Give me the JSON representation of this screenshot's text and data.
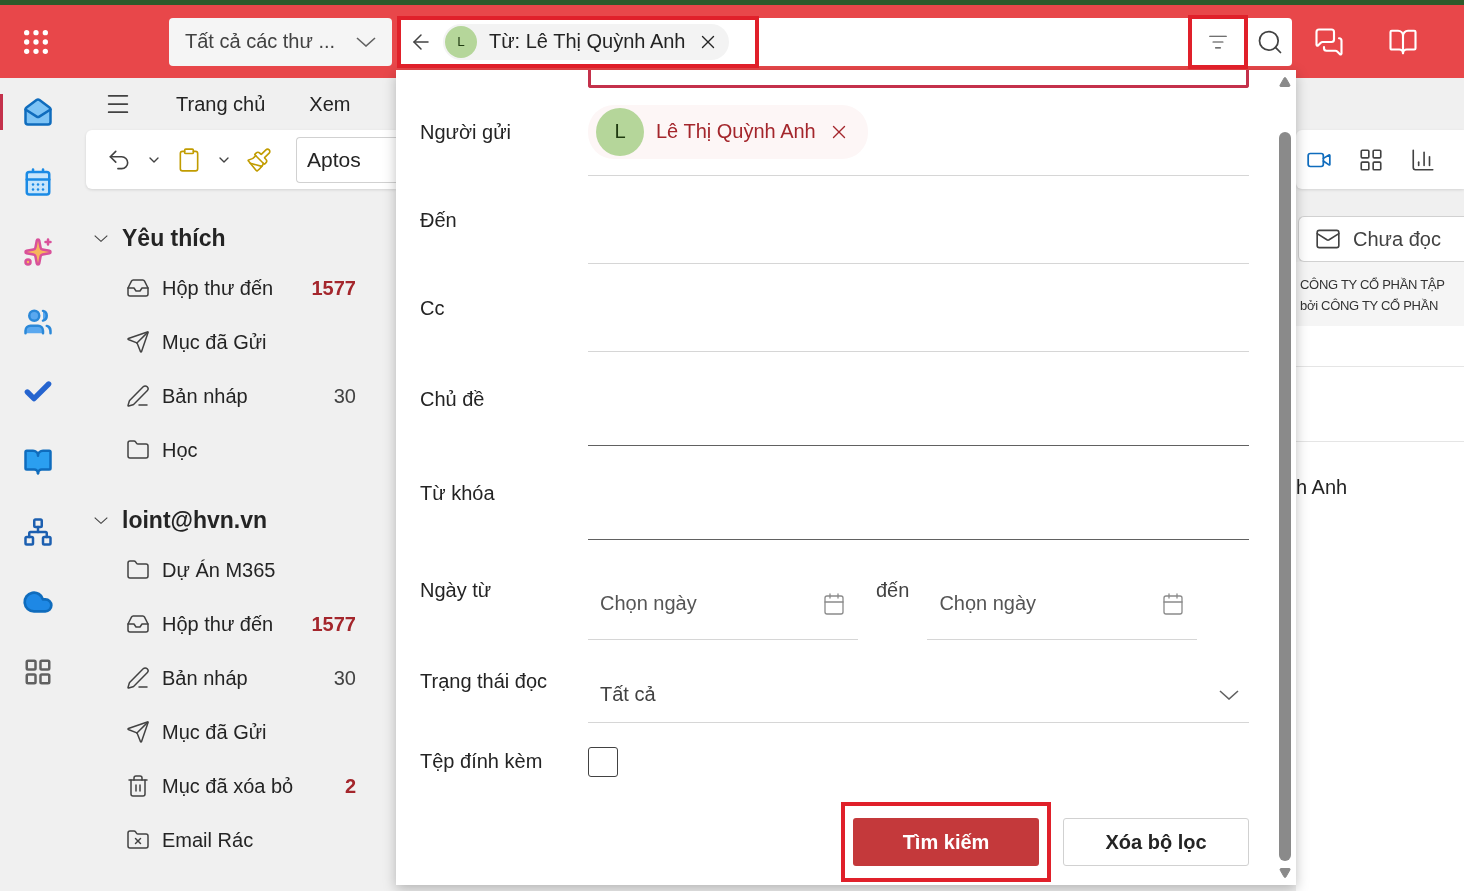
{
  "header": {
    "scope": "Tất cả các thư ...",
    "search_chip": {
      "initial": "L",
      "label": "Từ: Lê Thị Quỳnh Anh",
      "highlighted": true
    },
    "filter_button": {
      "highlighted": true
    }
  },
  "rail": [
    {
      "kind": "mail",
      "selected": true
    },
    {
      "kind": "calendar",
      "selected": false
    },
    {
      "kind": "copilot",
      "selected": false
    },
    {
      "kind": "people",
      "selected": false
    },
    {
      "kind": "todo",
      "selected": false
    },
    {
      "kind": "notes",
      "selected": false
    },
    {
      "kind": "org",
      "selected": false
    },
    {
      "kind": "cloud",
      "selected": false
    },
    {
      "kind": "apps",
      "selected": false
    }
  ],
  "ribbon": {
    "tabs": [
      "Trang chủ",
      "Xem"
    ],
    "font": "Aptos"
  },
  "folders": [
    {
      "title": "Yêu thích",
      "expanded": true,
      "children": [
        {
          "kind": "inbox",
          "label": "Hộp thư đến",
          "count": "1577",
          "unread": true
        },
        {
          "kind": "sent",
          "label": "Mục đã Gửi"
        },
        {
          "kind": "drafts",
          "label": "Bản nháp",
          "count": "30",
          "unread": false
        },
        {
          "kind": "folder",
          "label": "Học"
        }
      ]
    },
    {
      "title": "loint@hvn.vn",
      "expanded": true,
      "children": [
        {
          "kind": "folder",
          "label": "Dự Án M365"
        },
        {
          "kind": "inbox",
          "label": "Hộp thư đến",
          "count": "1577",
          "unread": true
        },
        {
          "kind": "drafts",
          "label": "Bản nháp",
          "count": "30",
          "unread": false
        },
        {
          "kind": "sent",
          "label": "Mục đã Gửi"
        },
        {
          "kind": "trash",
          "label": "Mục đã xóa bỏ",
          "count": "2",
          "unread": true
        },
        {
          "kind": "junk",
          "label": "Email Rác"
        }
      ]
    }
  ],
  "content": {
    "unread_filter": "Chưa đọc",
    "preview_lines": [
      "CÔNG TY CỔ PHẦN TẬP",
      "bởi CÔNG TY CỔ PHẦN"
    ],
    "message_sender": "h Anh"
  },
  "search_panel": {
    "fields": [
      {
        "kind": "people",
        "label": "Người gửi",
        "person": {
          "initial": "L",
          "name": "Lê Thị Quỳnh Anh"
        }
      },
      {
        "kind": "people",
        "label": "Đến"
      },
      {
        "kind": "people",
        "label": "Cc"
      },
      {
        "kind": "text",
        "label": "Chủ đề"
      },
      {
        "kind": "text",
        "label": "Từ khóa"
      },
      {
        "kind": "date",
        "label": "Ngày từ",
        "from_placeholder": "Chọn ngày",
        "between": "đến",
        "to_placeholder": "Chọn ngày"
      },
      {
        "kind": "select",
        "label": "Trạng thái đọc",
        "value": "Tất cả"
      },
      {
        "kind": "checkbox",
        "label": "Tệp đính kèm",
        "checked": false
      }
    ],
    "search_button": {
      "label": "Tìm kiếm",
      "highlighted": true
    },
    "clear_button": {
      "label": "Xóa bộ lọc"
    }
  }
}
